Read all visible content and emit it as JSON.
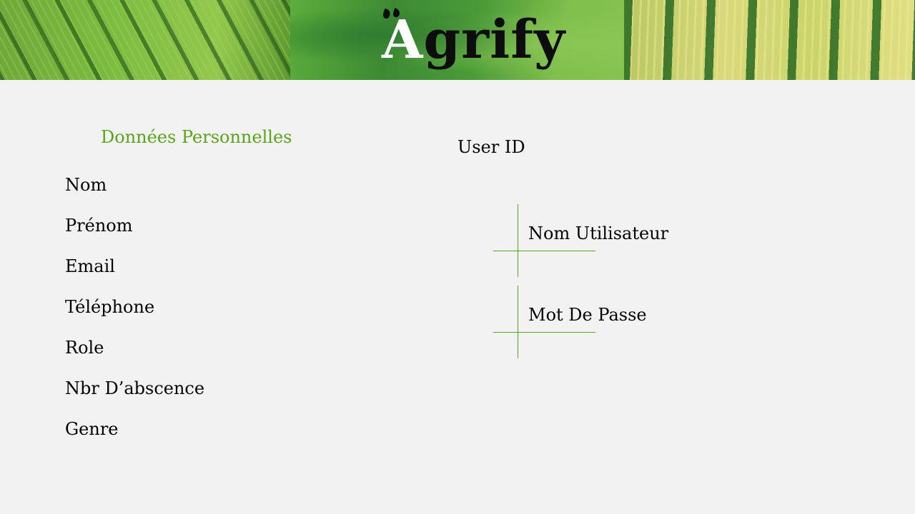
{
  "header": {
    "logo_text": "Agrify",
    "logo_first_letter": "A",
    "logo_rest": "grify"
  },
  "personal": {
    "title": "Données Personnelles",
    "fields": [
      "Nom",
      "Prénom",
      "Email",
      "Téléphone",
      "Role",
      "Nbr D’abscence",
      "Genre"
    ]
  },
  "account": {
    "user_id_label": "User ID",
    "username_label": "Nom Utilisateur",
    "password_label": "Mot De Passe"
  },
  "colors": {
    "accent": "#5aa41c",
    "background": "#f2f2f2",
    "text": "#000000"
  }
}
